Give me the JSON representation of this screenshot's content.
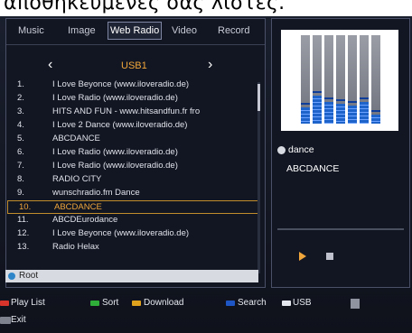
{
  "caption": "αποθηκευμένες σας λίστες.",
  "tabs": [
    "Music",
    "Image",
    "Web Radio",
    "Video",
    "Record"
  ],
  "active_tab": "Web Radio",
  "folder_nav": {
    "prev": "‹",
    "label": "USB1",
    "next": "›"
  },
  "stations": [
    {
      "num": "1.",
      "name": "I Love Beyonce (www.iloveradio.de)"
    },
    {
      "num": "2.",
      "name": "I Love Radio (www.iloveradio.de)"
    },
    {
      "num": "3.",
      "name": "HITS AND FUN - www.hitsandfun.fr fro"
    },
    {
      "num": "4.",
      "name": "I Love 2 Dance (www.iloveradio.de)"
    },
    {
      "num": "5.",
      "name": "ABCDANCE"
    },
    {
      "num": "6.",
      "name": "I Love Radio (www.iloveradio.de)"
    },
    {
      "num": "7.",
      "name": "I Love Radio (www.iloveradio.de)"
    },
    {
      "num": "8.",
      "name": "RADIO CITY"
    },
    {
      "num": "9.",
      "name": "wunschradio.fm Dance"
    },
    {
      "num": "10.",
      "name": "ABCDANCE"
    },
    {
      "num": "11.",
      "name": "ABCDEurodance"
    },
    {
      "num": "12.",
      "name": "I Love Beyonce (www.iloveradio.de)"
    },
    {
      "num": "13.",
      "name": "Radio Helax"
    }
  ],
  "selected_index": 9,
  "root_label": "Root",
  "now_playing": {
    "genre": "dance",
    "station": "ABCDANCE"
  },
  "equalizer_levels": [
    0.18,
    0.32,
    0.24,
    0.22,
    0.2,
    0.24,
    0.1
  ],
  "legend": [
    {
      "label": "Play List",
      "color": "#d9342b"
    },
    {
      "label": "Sort",
      "color": "#2fae3a"
    },
    {
      "label": "Download",
      "color": "#e0a21c"
    },
    {
      "label": "Search",
      "color": "#1e56c6"
    },
    {
      "label": "USB",
      "color": "#e6e8ef"
    },
    {
      "label": "Exit",
      "color": "#7e828e"
    }
  ],
  "icons": {
    "root": "folder-dot-icon",
    "play": "play-icon",
    "stop": "stop-icon",
    "info": "info-icon"
  }
}
